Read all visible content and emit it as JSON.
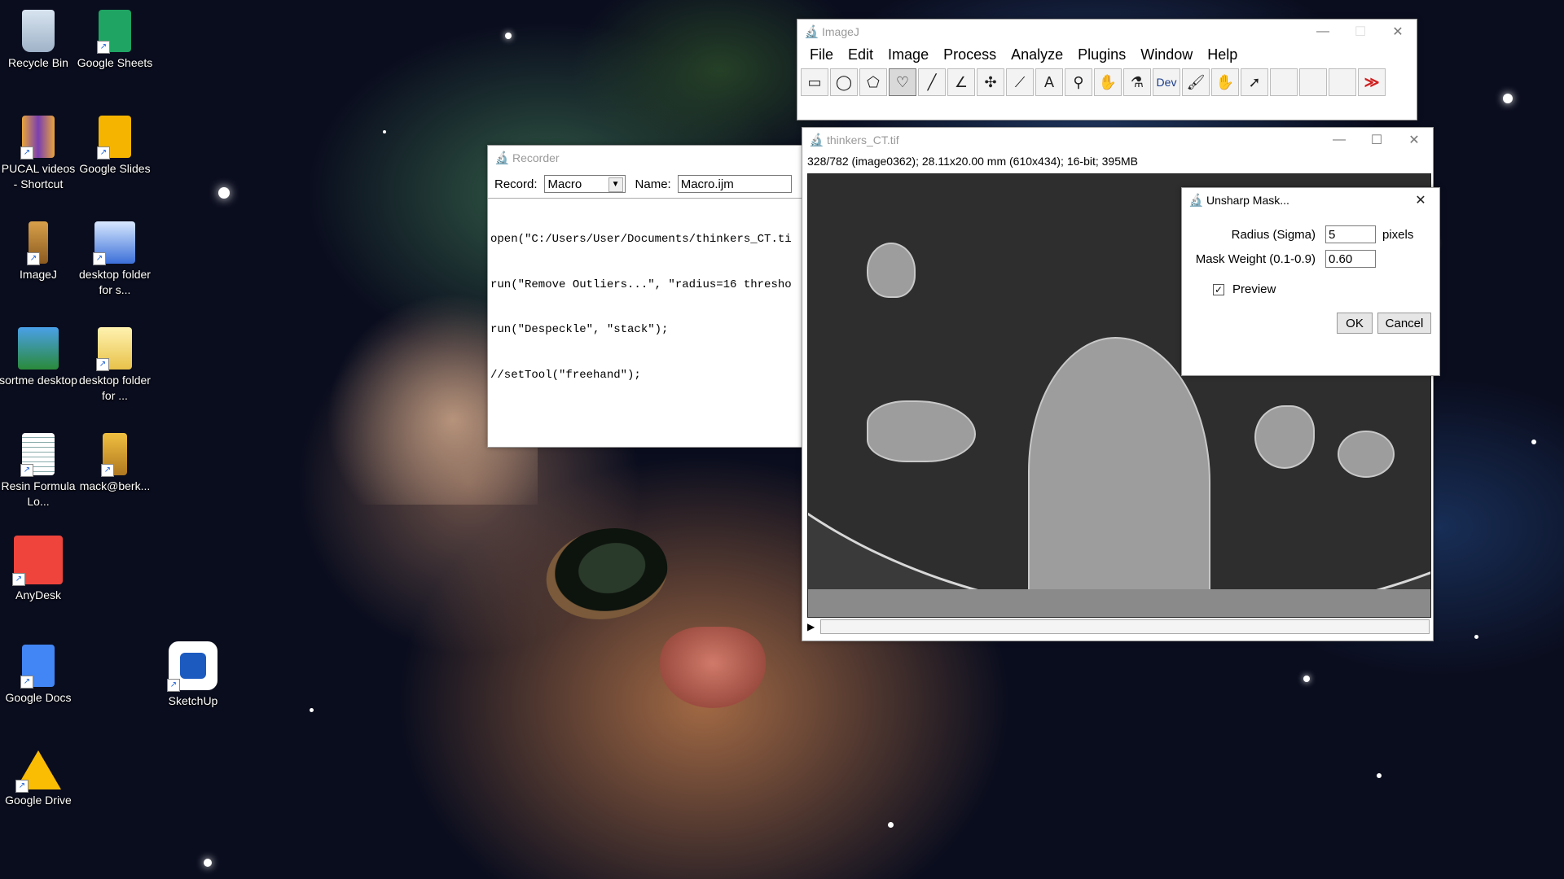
{
  "desktop": {
    "icons": [
      {
        "label": "Recycle Bin",
        "icon": "recycle-bin-icon"
      },
      {
        "label": "Google Sheets",
        "icon": "google-sheets-icon"
      },
      {
        "label": "PUCAL videos - Shortcut",
        "icon": "folder-shortcut-icon"
      },
      {
        "label": "Google Slides",
        "icon": "google-slides-icon"
      },
      {
        "label": "ImageJ",
        "icon": "imagej-icon"
      },
      {
        "label": "desktop folder for s...",
        "icon": "monitor-icon"
      },
      {
        "label": "sortme desktop",
        "icon": "computer-icon"
      },
      {
        "label": "desktop folder for ...",
        "icon": "folder-icon"
      },
      {
        "label": "Resin Formula Lo...",
        "icon": "document-icon"
      },
      {
        "label": "mack@berk...",
        "icon": "remote-device-icon"
      },
      {
        "label": "AnyDesk",
        "icon": "anydesk-icon"
      },
      {
        "label": "Google Docs",
        "icon": "google-docs-icon"
      },
      {
        "label": "SketchUp",
        "icon": "sketchup-icon"
      },
      {
        "label": "Google Drive",
        "icon": "google-drive-icon"
      }
    ]
  },
  "imagej": {
    "title": "ImageJ",
    "menu": [
      "File",
      "Edit",
      "Image",
      "Process",
      "Analyze",
      "Plugins",
      "Window",
      "Help"
    ],
    "tools": [
      "rectangle-tool",
      "oval-tool",
      "polygon-tool",
      "freehand-tool",
      "line-tool",
      "angle-tool",
      "point-tool",
      "wand-tool",
      "text-tool",
      "magnifier-tool",
      "scroll-tool",
      "color-picker-tool",
      "dev-menu",
      "brush-tool",
      "flood-fill-tool",
      "arrow-tool",
      "empty-slot",
      "empty-slot",
      "empty-slot",
      "more-tools"
    ],
    "dev_label": "Dev",
    "more_label": "≫"
  },
  "recorder": {
    "title": "Recorder",
    "record_label": "Record:",
    "record_value": "Macro",
    "name_label": "Name:",
    "name_value": "Macro.ijm",
    "code_lines": [
      "open(\"C:/Users/User/Documents/thinkers_CT.ti",
      "run(\"Remove Outliers...\", \"radius=16 thresho",
      "run(\"Despeckle\", \"stack\");",
      "//setTool(\"freehand\");"
    ]
  },
  "image_window": {
    "title": "thinkers_CT.tif",
    "info": "328/782 (image0362); 28.11x20.00 mm (610x434); 16-bit; 395MB"
  },
  "dialog": {
    "title": "Unsharp Mask...",
    "radius_label": "Radius (Sigma)",
    "radius_value": "5",
    "radius_unit": "pixels",
    "weight_label": "Mask Weight (0.1-0.9)",
    "weight_value": "0.60",
    "preview_label": "Preview",
    "preview_checked": true,
    "ok_label": "OK",
    "cancel_label": "Cancel"
  }
}
